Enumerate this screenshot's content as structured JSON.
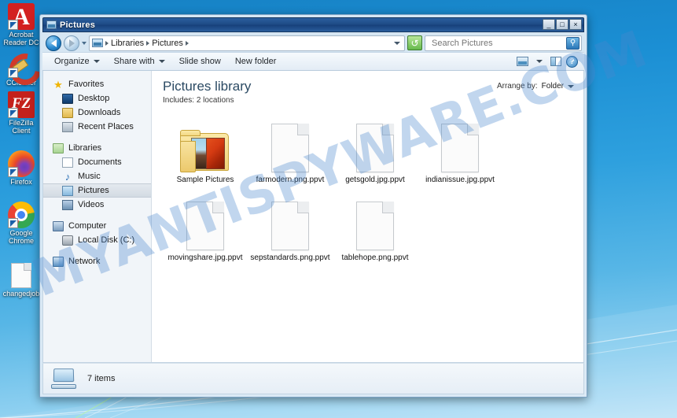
{
  "desktop": {
    "icons": [
      {
        "label": "Acrobat Reader DC",
        "icon": "acrobat-reader-icon",
        "shortcut": true
      },
      {
        "label": "CCleaner",
        "icon": "ccleaner-icon",
        "shortcut": true
      },
      {
        "label": "FileZilla Client",
        "icon": "filezilla-icon",
        "shortcut": true
      },
      {
        "label": "Firefox",
        "icon": "firefox-icon",
        "shortcut": true
      },
      {
        "label": "Google Chrome",
        "icon": "chrome-icon",
        "shortcut": true
      },
      {
        "label": "changedjob",
        "icon": "blank-file-icon",
        "shortcut": false
      }
    ]
  },
  "watermark": {
    "text": "MYANTISPYWARE.COM",
    "color": "#4a86cd"
  },
  "window": {
    "title": "Pictures",
    "title_icon": "pictures-library-icon",
    "buttons": {
      "minimize": "_",
      "maximize": "□",
      "close": "×"
    }
  },
  "navbar": {
    "back_icon": "back-arrow-icon",
    "forward_icon": "forward-arrow-icon",
    "history_icon": "recent-pages-chevron-icon",
    "address": {
      "icon": "library-icon",
      "crumbs": [
        "Libraries",
        "Pictures"
      ],
      "dropdown_icon": "address-dropdown-icon"
    },
    "refresh_icon": "refresh-icon",
    "search": {
      "placeholder": "Search Pictures",
      "value": "",
      "icon": "search-icon"
    }
  },
  "toolbar": {
    "items": [
      {
        "label": "Organize",
        "has_caret": true
      },
      {
        "label": "Share with",
        "has_caret": true
      },
      {
        "label": "Slide show",
        "has_caret": false
      },
      {
        "label": "New folder",
        "has_caret": false
      }
    ],
    "right_icons": [
      {
        "name": "change-view-icon"
      },
      {
        "name": "view-dropdown-caret-icon"
      },
      {
        "name": "preview-pane-icon"
      },
      {
        "name": "help-icon",
        "glyph": "?"
      }
    ]
  },
  "navpane": {
    "groups": [
      {
        "header": {
          "label": "Favorites",
          "icon": "favorites-star-icon"
        },
        "items": [
          {
            "label": "Desktop",
            "icon": "desktop-icon"
          },
          {
            "label": "Downloads",
            "icon": "downloads-icon"
          },
          {
            "label": "Recent Places",
            "icon": "recent-places-icon"
          }
        ]
      },
      {
        "header": {
          "label": "Libraries",
          "icon": "libraries-icon"
        },
        "items": [
          {
            "label": "Documents",
            "icon": "documents-icon"
          },
          {
            "label": "Music",
            "icon": "music-icon"
          },
          {
            "label": "Pictures",
            "icon": "pictures-icon",
            "selected": true
          },
          {
            "label": "Videos",
            "icon": "videos-icon"
          }
        ]
      },
      {
        "header": {
          "label": "Computer",
          "icon": "computer-icon"
        },
        "items": [
          {
            "label": "Local Disk (C:)",
            "icon": "local-disk-icon"
          }
        ]
      },
      {
        "header": {
          "label": "Network",
          "icon": "network-icon"
        },
        "items": []
      }
    ]
  },
  "library": {
    "title": "Pictures library",
    "includes_label": "Includes:",
    "includes_value": "2 locations",
    "arrange_label": "Arrange by:",
    "arrange_value": "Folder",
    "arrange_caret_icon": "arrange-caret-icon"
  },
  "files": [
    {
      "name": "Sample Pictures",
      "type": "folder",
      "icon": "folder-with-pictures-icon"
    },
    {
      "name": "farmodern.png.ppvt",
      "type": "file",
      "icon": "blank-file-icon"
    },
    {
      "name": "getsgold.jpg.ppvt",
      "type": "file",
      "icon": "blank-file-icon"
    },
    {
      "name": "indianissue.jpg.ppvt",
      "type": "file",
      "icon": "blank-file-icon"
    },
    {
      "name": "movingshare.jpg.ppvt",
      "type": "file",
      "icon": "blank-file-icon"
    },
    {
      "name": "sepstandards.png.ppvt",
      "type": "file",
      "icon": "blank-file-icon"
    },
    {
      "name": "tablehope.png.ppvt",
      "type": "file",
      "icon": "blank-file-icon"
    }
  ],
  "statusbar": {
    "icon": "computer-status-icon",
    "text": "7 items"
  }
}
